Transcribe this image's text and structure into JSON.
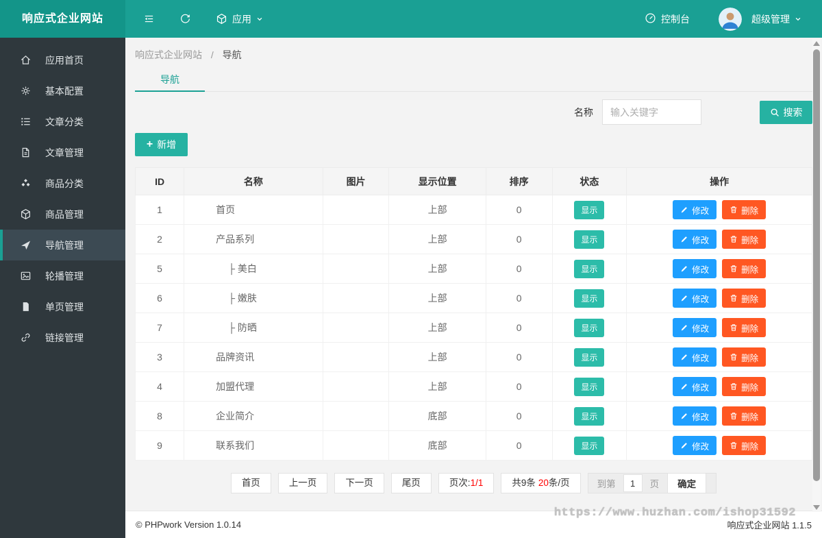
{
  "header": {
    "logo_text": "响应式企业网站",
    "app_menu_label": "应用",
    "console_label": "控制台",
    "user_label": "超级管理"
  },
  "sidebar": {
    "items": [
      {
        "key": "app-home",
        "icon": "home-icon",
        "label": "应用首页",
        "active": false
      },
      {
        "key": "basic-config",
        "icon": "gear-icon",
        "label": "基本配置",
        "active": false
      },
      {
        "key": "article-category",
        "icon": "list-icon",
        "label": "文章分类",
        "active": false
      },
      {
        "key": "article-manage",
        "icon": "file-icon",
        "label": "文章管理",
        "active": false
      },
      {
        "key": "product-category",
        "icon": "cubes-icon",
        "label": "商品分类",
        "active": false
      },
      {
        "key": "product-manage",
        "icon": "cube-icon",
        "label": "商品管理",
        "active": false
      },
      {
        "key": "nav-manage",
        "icon": "send-icon",
        "label": "导航管理",
        "active": true
      },
      {
        "key": "carousel-manage",
        "icon": "image-icon",
        "label": "轮播管理",
        "active": false
      },
      {
        "key": "page-manage",
        "icon": "page-icon",
        "label": "单页管理",
        "active": false
      },
      {
        "key": "link-manage",
        "icon": "link-icon",
        "label": "链接管理",
        "active": false
      }
    ]
  },
  "breadcrumb": {
    "root": "响应式企业网站",
    "separator": "/",
    "current": "导航"
  },
  "tab": {
    "label": "导航"
  },
  "search": {
    "label": "名称",
    "placeholder": "输入关键字",
    "button_label": "搜索"
  },
  "toolbar": {
    "add_icon": "+",
    "add_label": "新增"
  },
  "table": {
    "headers": [
      "ID",
      "名称",
      "图片",
      "显示位置",
      "排序",
      "状态",
      "操作"
    ],
    "actions": {
      "edit": "修改",
      "delete": "删除"
    },
    "rows": [
      {
        "id": "1",
        "name": "首页",
        "image": "",
        "position": "上部",
        "sort": "0",
        "status": "显示",
        "child": false
      },
      {
        "id": "2",
        "name": "产品系列",
        "image": "",
        "position": "上部",
        "sort": "0",
        "status": "显示",
        "child": false
      },
      {
        "id": "5",
        "name": "├ 美白",
        "image": "",
        "position": "上部",
        "sort": "0",
        "status": "显示",
        "child": true
      },
      {
        "id": "6",
        "name": "├ 嫩肤",
        "image": "",
        "position": "上部",
        "sort": "0",
        "status": "显示",
        "child": true
      },
      {
        "id": "7",
        "name": "├ 防晒",
        "image": "",
        "position": "上部",
        "sort": "0",
        "status": "显示",
        "child": true
      },
      {
        "id": "3",
        "name": "品牌资讯",
        "image": "",
        "position": "上部",
        "sort": "0",
        "status": "显示",
        "child": false
      },
      {
        "id": "4",
        "name": "加盟代理",
        "image": "",
        "position": "上部",
        "sort": "0",
        "status": "显示",
        "child": false
      },
      {
        "id": "8",
        "name": "企业简介",
        "image": "",
        "position": "底部",
        "sort": "0",
        "status": "显示",
        "child": false
      },
      {
        "id": "9",
        "name": "联系我们",
        "image": "",
        "position": "底部",
        "sort": "0",
        "status": "显示",
        "child": false
      }
    ]
  },
  "pagination": {
    "first": "首页",
    "prev": "上一页",
    "next": "下一页",
    "last": "尾页",
    "page_label": "页次:",
    "page_value": "1/1",
    "total_label": "共9条",
    "per_page_value": "20",
    "per_page_suffix": "条/页",
    "goto_label": "到第",
    "goto_value": "1",
    "goto_suffix": "页",
    "confirm": "确定"
  },
  "footer": {
    "copyright": "© PHPwork Version 1.0.14",
    "watermark": "https://www.huzhan.com/ishop31592",
    "version": "响应式企业网站 1.1.5"
  },
  "colors": {
    "header_teal": "#1aa094",
    "button_teal": "#26b2a2",
    "badge_teal": "#2cbca9",
    "edit_blue": "#1e9fff",
    "delete_orange": "#ff5722",
    "sidebar_dark": "#2f383d",
    "pagination_red": "#ff0000"
  }
}
